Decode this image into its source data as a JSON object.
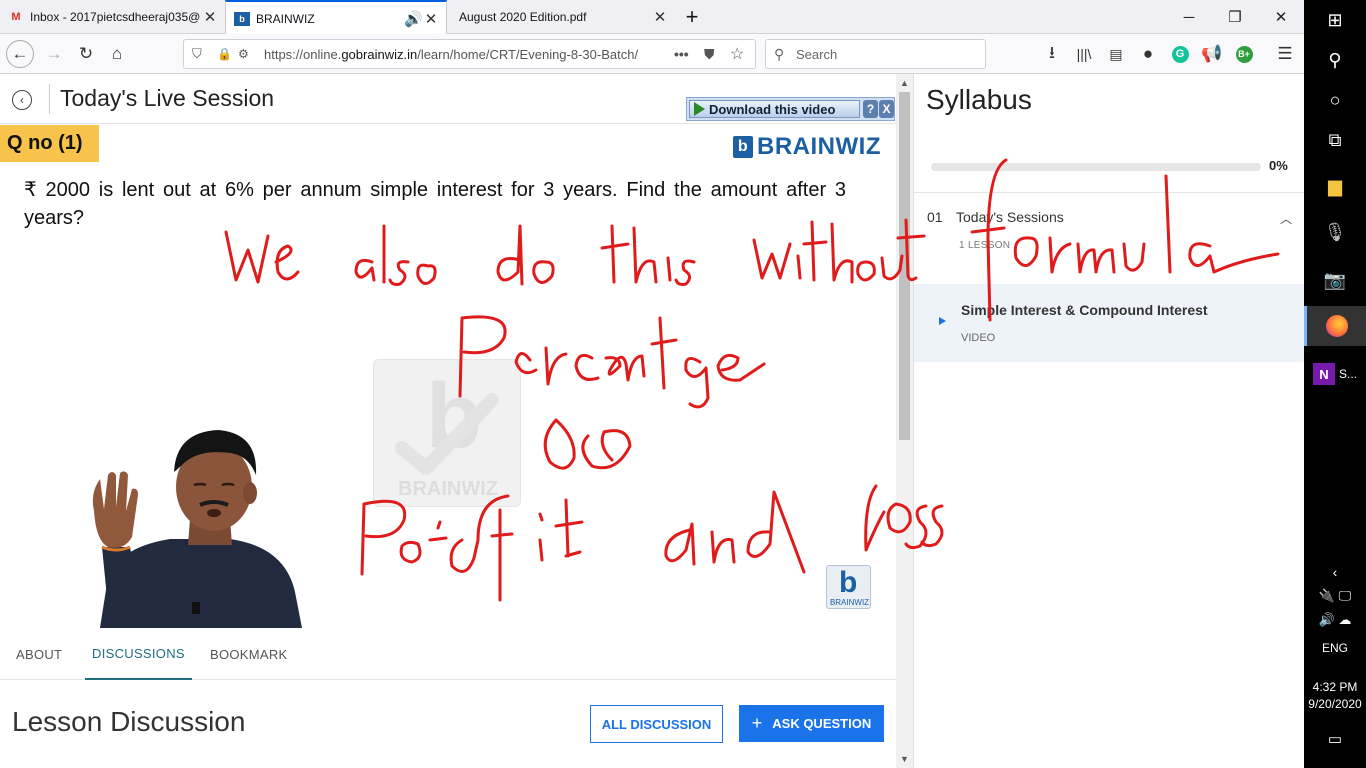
{
  "browser": {
    "tabs": [
      {
        "label": "Inbox - 2017pietcsdheeraj035@",
        "icon": "gmail-icon"
      },
      {
        "label": "BRAINWIZ",
        "icon": "brainwiz-favicon"
      },
      {
        "label": "August 2020 Edition.pdf",
        "icon": ""
      }
    ],
    "url_prefix": "https://online.",
    "url_domain": "gobrainwiz.in",
    "url_path": "/learn/home/CRT/Evening-8-30-Batch/",
    "search_placeholder": "Search",
    "extensions": [
      "G",
      "B+"
    ]
  },
  "session": {
    "title": "Today's Live Session",
    "download_label": "Download this video",
    "download_help": "?",
    "download_close": "X"
  },
  "video": {
    "question_number": "Q no (1)",
    "brand": "BRAINWIZ",
    "question_text": "₹ 2000 is lent out at 6% per annum simple interest for 3 years. Find the amount after 3 years?",
    "watermark_text": "BRAINWIZ",
    "small_logo_text": "BRAINWIZ",
    "annotations": [
      "We also do this without formula",
      "Percentage",
      "(or)",
      "Profit and loss"
    ]
  },
  "lesson_tabs": [
    {
      "label": "ABOUT",
      "active": false
    },
    {
      "label": "DISCUSSIONS",
      "active": true
    },
    {
      "label": "BOOKMARK",
      "active": false
    }
  ],
  "discussion": {
    "title": "Lesson Discussion",
    "all_button": "ALL DISCUSSION",
    "ask_button": "ASK QUESTION",
    "ask_icon": "+"
  },
  "syllabus": {
    "title": "Syllabus",
    "progress_fraction": 0,
    "progress_label": "0%",
    "section": {
      "number": "01",
      "title": "Today's Sessions",
      "subtitle": "1 LESSON"
    },
    "lesson": {
      "title": "Simple Interest & Compound Interest",
      "type": "VIDEO"
    }
  },
  "taskbar": {
    "app_label": "S...",
    "language": "ENG",
    "time": "4:32 PM",
    "date": "9/20/2020"
  },
  "colors": {
    "accent": "#1a73e8",
    "qno_badge": "#f7c34a",
    "ink": "#e01b1b",
    "brand": "#1d5fa3"
  }
}
